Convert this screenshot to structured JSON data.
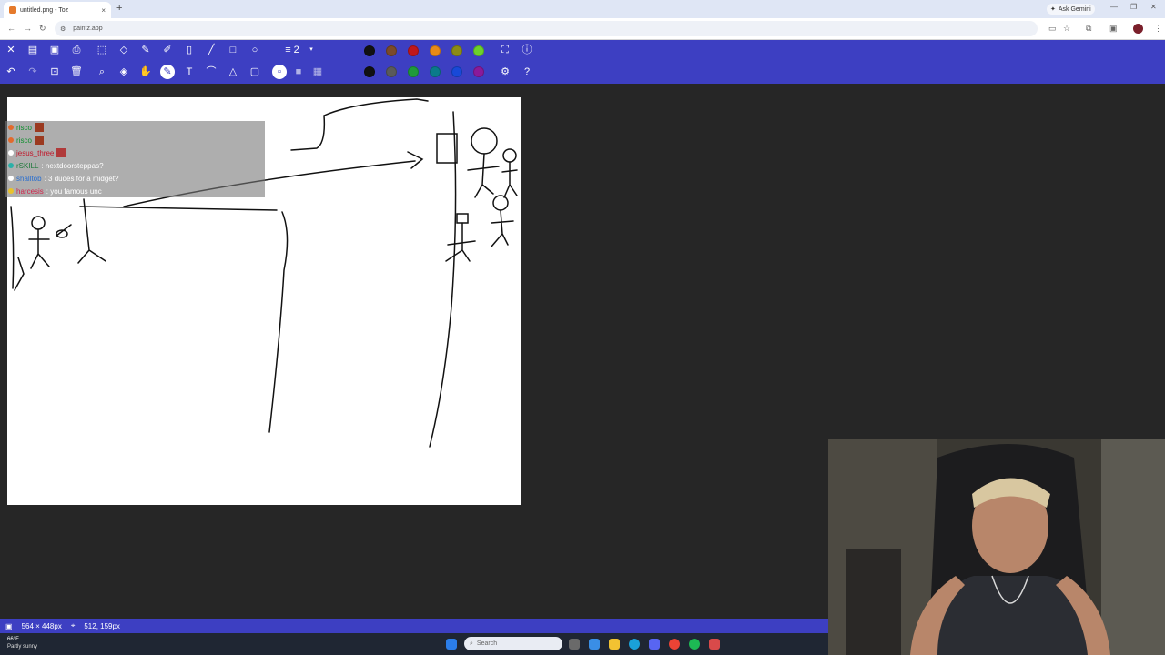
{
  "browser": {
    "tab_title": "untitled.png - Toz",
    "new_tab": "+",
    "tab_close": "×",
    "gemini": "Ask Gemini",
    "url": "paintz.app",
    "min": "—",
    "max": "❐",
    "close": "✕"
  },
  "toolbar": {
    "stroke_size": "2",
    "palette_row1": [
      "#111111",
      "#7a4a2a",
      "#c0171b",
      "#e88a17",
      "#8b8b16",
      "#6cd12b"
    ],
    "palette_row2": [
      "#111111",
      "#5a5a5a",
      "#1f9a3a",
      "#0a7a8a",
      "#1849d8",
      "#8a1a9a"
    ],
    "active_color": "#111111"
  },
  "chat": [
    {
      "user": "risco",
      "msg": ""
    },
    {
      "user": "risco",
      "msg": ""
    },
    {
      "user": "jesus_three",
      "msg": ""
    },
    {
      "user": "rSKILL",
      "msg": ": nextdoorsteppas?"
    },
    {
      "user": "shalltob",
      "msg": ": 3 dudes for a midget?"
    },
    {
      "user": "harcesis",
      "msg": ": you famous unc"
    }
  ],
  "statusbar": {
    "canvas_size": "564 × 448px",
    "cursor_pos": "512, 159px"
  },
  "taskbar": {
    "temp": "66°F",
    "weather": "Partly sunny",
    "search": "Search"
  }
}
